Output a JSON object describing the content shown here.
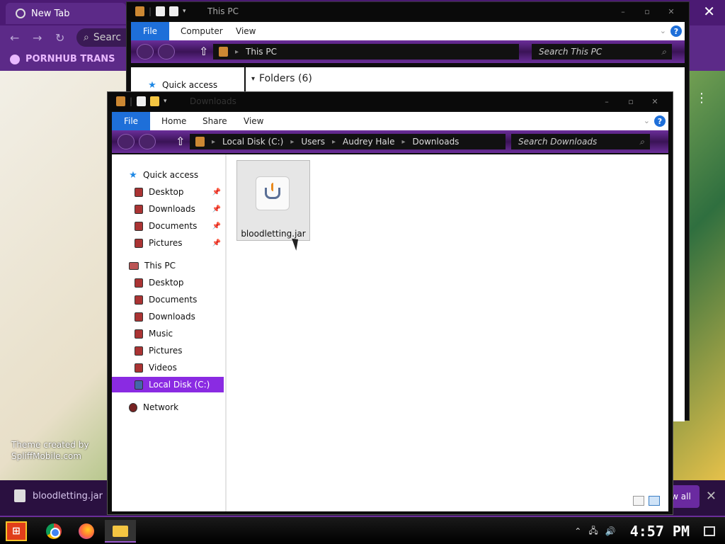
{
  "browser": {
    "tab_title": "New Tab",
    "search_placeholder": "Searc",
    "bookmark": "PORNHUB TRANS",
    "wallpaper_credit_line1": "Theme created by",
    "wallpaper_credit_line2": "SpliffMobile.com",
    "download_item": "bloodletting.jar",
    "show_all": "w all"
  },
  "thispc_window": {
    "title": "This PC",
    "ribbon": {
      "file": "File",
      "tabs": [
        "Computer",
        "View"
      ]
    },
    "address": "This PC",
    "search_placeholder": "Search This PC",
    "nav": {
      "quick_access": "Quick access"
    },
    "folders_header": "Folders (6)"
  },
  "downloads_window": {
    "title": "Downloads",
    "ribbon": {
      "file": "File",
      "tabs": [
        "Home",
        "Share",
        "View"
      ]
    },
    "breadcrumb": [
      "Local Disk (C:)",
      "Users",
      "Audrey Hale",
      "Downloads"
    ],
    "search_placeholder": "Search Downloads",
    "nav": {
      "quick_access": "Quick access",
      "quick_items": [
        "Desktop",
        "Downloads",
        "Documents",
        "Pictures"
      ],
      "this_pc": "This PC",
      "pc_items": [
        "Desktop",
        "Documents",
        "Downloads",
        "Music",
        "Pictures",
        "Videos",
        "Local Disk (C:)"
      ],
      "network": "Network"
    },
    "file": {
      "name": "bloodletting.jar",
      "icon": "java-jar-icon"
    }
  },
  "taskbar": {
    "apps": [
      "chrome-icon",
      "firefox-icon",
      "file-explorer-icon"
    ],
    "clock": "4:57 PM"
  },
  "colors": {
    "accent_purple": "#8a2be2",
    "ribbon_file_blue": "#1e6fd9"
  }
}
